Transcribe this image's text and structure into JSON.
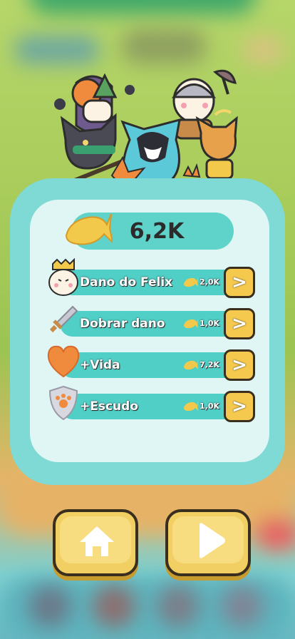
{
  "currency": {
    "value": "6,2K",
    "icon": "fish-cookie-icon"
  },
  "upgrades": [
    {
      "label": "Dano do Felix",
      "cost": "2,0K",
      "icon": "felix-cat-icon",
      "action": ">"
    },
    {
      "label": "Dobrar dano",
      "cost": "1,0K",
      "icon": "sword-icon",
      "action": ">"
    },
    {
      "label": "+Vida",
      "cost": "7,2K",
      "icon": "heart-icon",
      "action": ">"
    },
    {
      "label": "+Escudo",
      "cost": "1,0K",
      "icon": "paw-shield-icon",
      "action": ">"
    }
  ],
  "buttons": {
    "home": "home-icon",
    "play": "play-icon"
  },
  "colors": {
    "panel": "#7fd9d4",
    "bar": "#4fcfc6",
    "button": "#f2cf62",
    "accent": "#f08a3c"
  }
}
